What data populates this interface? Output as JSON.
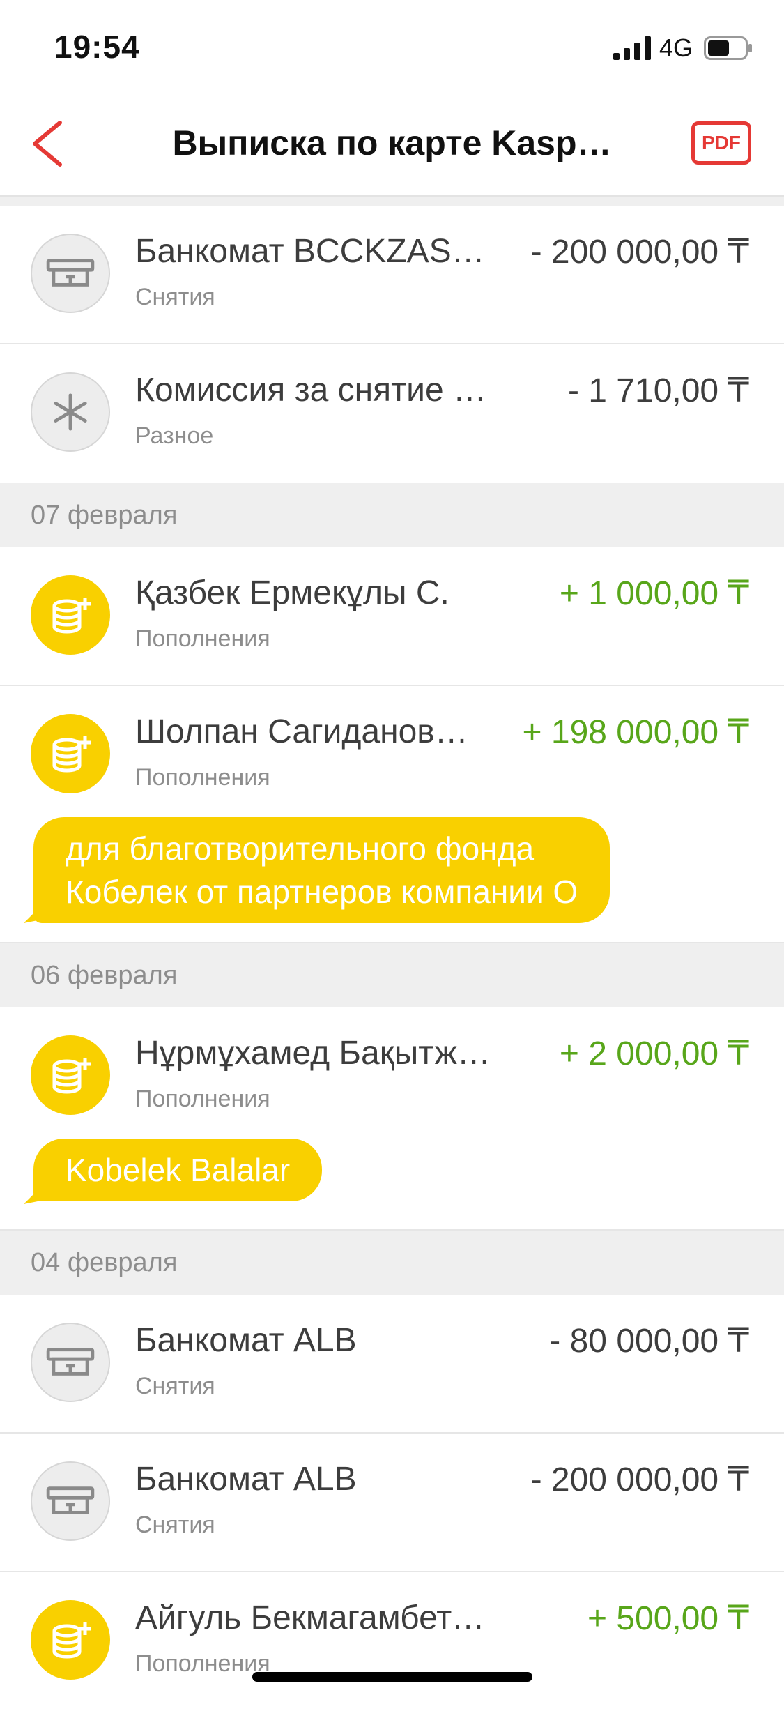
{
  "status": {
    "time": "19:54",
    "network": "4G"
  },
  "nav": {
    "title": "Выписка по карте Kasp…",
    "pdf_label": "PDF"
  },
  "sections": [
    {
      "date": "",
      "rows": [
        {
          "title": "Банкомат BCCKZAS…",
          "category": "Снятия",
          "amount": "- 200 000,00 ₸",
          "type": "atm"
        },
        {
          "title": "Комиссия за снятие на…",
          "category": "Разное",
          "amount": "- 1 710,00 ₸",
          "type": "misc"
        }
      ]
    },
    {
      "date": "07 февраля",
      "rows": [
        {
          "title": "Қазбек Ермекұлы С.",
          "category": "Пополнения",
          "amount": "+ 1 000,00 ₸",
          "type": "topup"
        },
        {
          "title": "Шолпан Сагиданов…",
          "category": "Пополнения",
          "amount": "+ 198 000,00 ₸",
          "type": "topup",
          "comment": "для благотворительного фонда\nКобелек от партнеров компании О"
        }
      ]
    },
    {
      "date": "06 февраля",
      "rows": [
        {
          "title": "Нұрмұхамед Бақытжа…",
          "category": "Пополнения",
          "amount": "+ 2 000,00 ₸",
          "type": "topup",
          "comment": "Kobelek Balalar"
        }
      ]
    },
    {
      "date": "04 февраля",
      "rows": [
        {
          "title": "Банкомат ALB",
          "category": "Снятия",
          "amount": "- 80 000,00 ₸",
          "type": "atm"
        },
        {
          "title": "Банкомат ALB",
          "category": "Снятия",
          "amount": "- 200 000,00 ₸",
          "type": "atm"
        },
        {
          "title": "Айгуль Бекмагамбетов…",
          "category": "Пополнения",
          "amount": "+ 500,00 ₸",
          "type": "topup"
        }
      ]
    }
  ],
  "icons": {
    "atm": "atm-icon",
    "misc": "asterisk-icon",
    "topup": "coins-plus-icon",
    "back": "back-chevron-icon"
  },
  "colors": {
    "accent_yellow": "#f9d000",
    "income_green": "#58a61a",
    "pdf_red": "#e53935"
  }
}
